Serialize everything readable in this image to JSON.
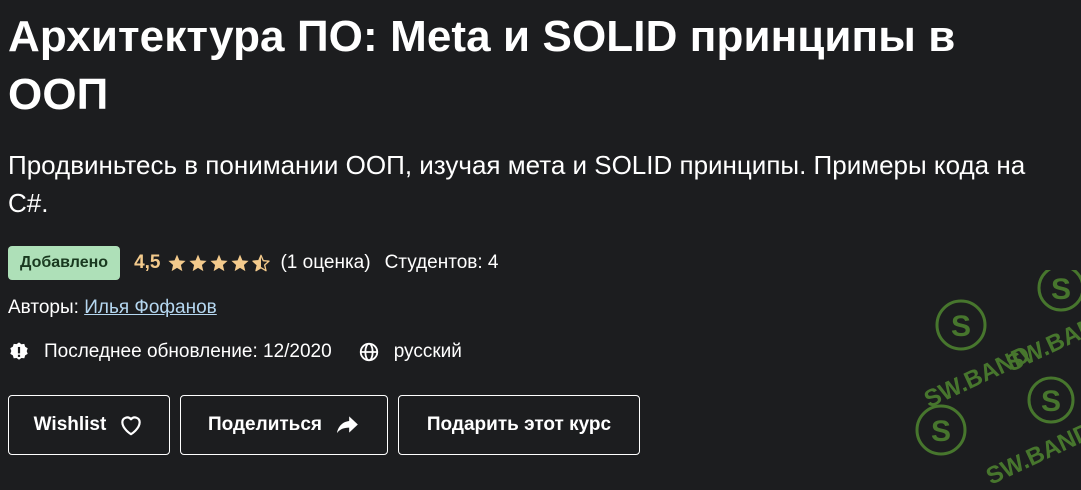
{
  "course": {
    "title": "Архитектура ПО: Meta и SOLID принципы в ООП",
    "subtitle": "Продвиньтесь в понимании ООП, изучая мета и SOLID принципы. Примеры кода на C#."
  },
  "rating": {
    "badge": "Добавлено",
    "value": "4,5",
    "stars_value": 4.5,
    "stars_max": 5,
    "count_text": "(1 оценка)",
    "students_text": "Студентов: 4"
  },
  "authors": {
    "label": "Авторы:",
    "name": "Илья Фофанов"
  },
  "info": {
    "updated_text": "Последнее обновление: 12/2020",
    "language": "русский"
  },
  "buttons": {
    "wishlist": "Wishlist",
    "share": "Поделиться",
    "gift": "Подарить этот курс"
  },
  "watermark": {
    "text": "SW.BAND"
  },
  "colors": {
    "background": "#1c1d1f",
    "badge_bg": "#aee0b8",
    "rating": "#f3ca8c",
    "link": "#b5d7f0",
    "watermark": "#6bbf3a"
  },
  "icons": [
    "star-icon",
    "heart-icon",
    "share-arrow-icon",
    "badge-alert-icon",
    "globe-icon"
  ]
}
